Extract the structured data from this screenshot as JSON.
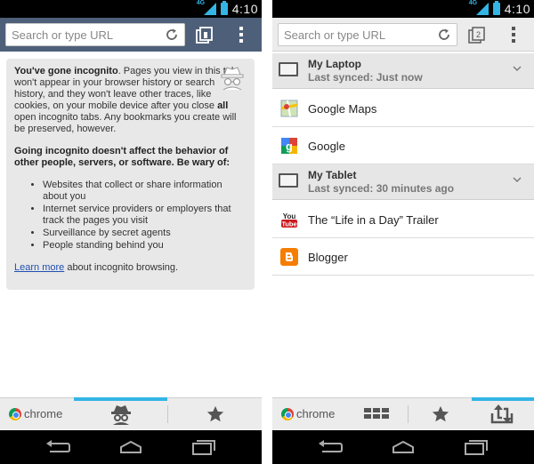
{
  "status_bar": {
    "network": "4G",
    "time": "4:10"
  },
  "toolbar": {
    "omnibox_placeholder": "Search or type URL",
    "tab_count_right": "2"
  },
  "incognito": {
    "title": "You've gone incognito",
    "para1_rest": ". Pages you view in this tab won't appear in your browser history or search history, and they won't leave other traces, like cookies, on your mobile device after you close ",
    "para1_all": "all",
    "para1_end": " open incognito tabs. Any bookmarks you create will be preserved, however.",
    "para2": "Going incognito doesn't affect the behavior of other people, servers, or software. Be wary of:",
    "list": [
      "Websites that collect or share information about you",
      "Internet service providers or employers that track the pages you visit",
      "Surveillance by secret agents",
      "People standing behind you"
    ],
    "learn_more": "Learn more",
    "learn_more_rest": " about incognito browsing."
  },
  "synced": {
    "devices": [
      {
        "name": "My Laptop",
        "synced": "Last synced: Just now",
        "items": [
          "Google  Maps",
          "Google"
        ]
      },
      {
        "name": "My Tablet",
        "synced": "Last synced: 30 minutes ago",
        "items": [
          "The “Life in a Day” Trailer",
          "Blogger"
        ]
      }
    ]
  },
  "bottom_bar": {
    "brand": "chrome"
  },
  "icons": {
    "reload": "reload-icon",
    "tabs": "tabs-icon",
    "menu": "overflow-menu-icon",
    "incognito": "incognito-spy-icon",
    "bookmarks": "star-icon",
    "most_visited": "grid-icon",
    "other_devices": "other-devices-icon",
    "back": "back-icon",
    "home": "home-icon",
    "recents": "recents-icon"
  },
  "colors": {
    "accent": "#33b5e5",
    "incognito_toolbar": "#4e6079",
    "link": "#1f4fb3"
  }
}
